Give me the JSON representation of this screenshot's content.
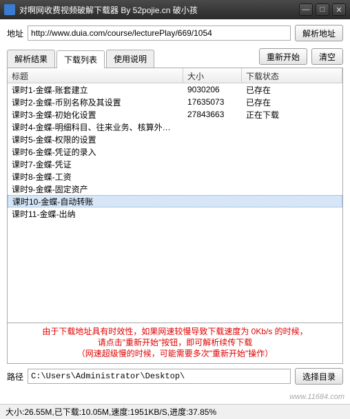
{
  "title": "对啊网收费视频破解下载器 By 52pojie.cn 破小孩",
  "url_label": "地址",
  "url_value": "http://www.duia.com/course/lecturePlay/669/1054",
  "parse_btn": "解析地址",
  "tabs": [
    {
      "label": "解析结果"
    },
    {
      "label": "下载列表"
    },
    {
      "label": "使用说明"
    }
  ],
  "active_tab": 1,
  "restart_btn": "重新开始",
  "clear_btn": "清空",
  "columns": {
    "title": "标题",
    "size": "大小",
    "status": "下载状态"
  },
  "rows": [
    {
      "title": "课时1-金蝶-账套建立",
      "size": "9030206",
      "status": "已存在"
    },
    {
      "title": "课时2-金蝶-币别名称及其设置",
      "size": "17635073",
      "status": "已存在"
    },
    {
      "title": "课时3-金蝶-初始化设置",
      "size": "27843663",
      "status": "正在下载"
    },
    {
      "title": "课时4-金蝶-明细科目、往来业务、核算外…",
      "size": "",
      "status": ""
    },
    {
      "title": "课时5-金蝶-权限的设置",
      "size": "",
      "status": ""
    },
    {
      "title": "课时6-金蝶-凭证的录入",
      "size": "",
      "status": ""
    },
    {
      "title": "课时7-金蝶-凭证",
      "size": "",
      "status": ""
    },
    {
      "title": "课时8-金蝶-工资",
      "size": "",
      "status": ""
    },
    {
      "title": "课时9-金蝶-固定资产",
      "size": "",
      "status": ""
    },
    {
      "title": "课时10-金蝶-自动转账",
      "size": "",
      "status": ""
    },
    {
      "title": "课时11-金蝶-出纳",
      "size": "",
      "status": ""
    }
  ],
  "selected_row": 9,
  "warning_lines": [
    "由于下载地址具有时效性，如果网速较慢导致下载速度为 0Kb/s 的时候，",
    "请点击\"重新开始\"按钮，即可解析续传下载",
    "（网速超级慢的时候，可能需要多次\"重新开始\"操作）"
  ],
  "path_label": "路径",
  "path_value": "C:\\Users\\Administrator\\Desktop\\",
  "choose_dir_btn": "选择目录",
  "status_text": "大小:26.55M,已下载:10.05M,速度:1951KB/S,进度:37.85%",
  "watermark": "www.11684.com",
  "win_controls": {
    "min": "—",
    "max": "□",
    "close": "✕"
  }
}
